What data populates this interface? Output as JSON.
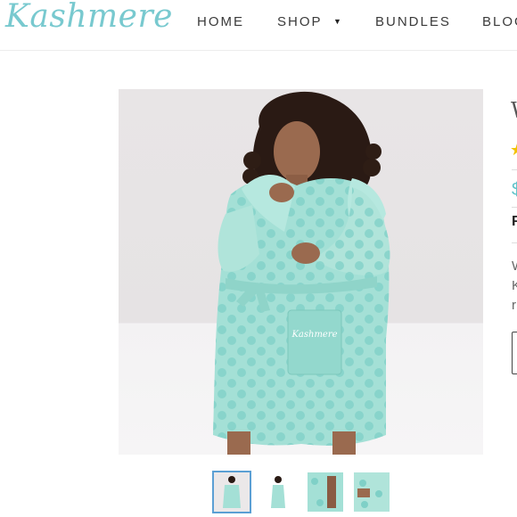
{
  "brand": {
    "logo_text": "Kashmere",
    "logo_color": "#78c9cf"
  },
  "nav": {
    "items": [
      {
        "label": "HOME"
      },
      {
        "label": "SHOP"
      },
      {
        "label": "BUNDLES"
      },
      {
        "label": "BLOG"
      }
    ],
    "shop_caret": "▼"
  },
  "product": {
    "image_alt": "Woman wearing mint polka-dot plush hooded robe with Kashmere embroidered pocket",
    "pocket_embroidery": "Kashmere",
    "robe_color": "#9fded4",
    "accent_color": "#5dc2c9",
    "title_initial": "W",
    "rating_star": "★",
    "price_initial": "$",
    "bold_initial": "F",
    "desc_lines": [
      "W",
      "K",
      "r"
    ]
  },
  "thumbnails": {
    "count": 4,
    "active_index": 0
  }
}
